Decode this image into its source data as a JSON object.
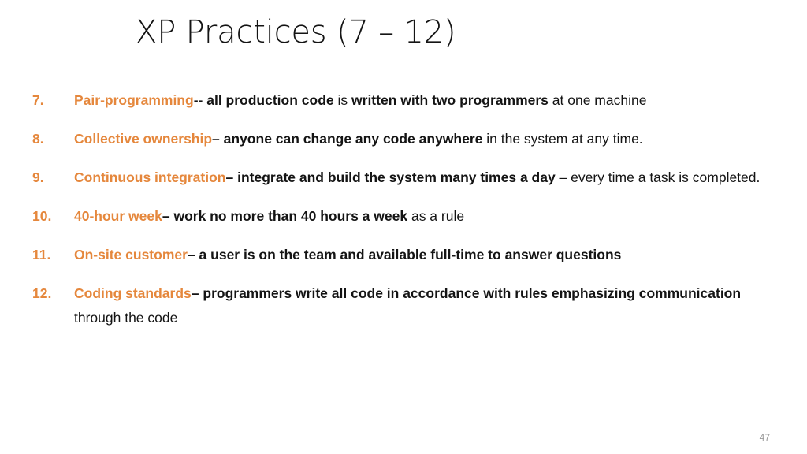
{
  "slide": {
    "title": "XP Practices (7 – 12)",
    "page_number": "47",
    "accent_color": "#E5873C",
    "text_color": "#141414",
    "background_color": "#FFFFFF"
  },
  "practices": [
    {
      "number": "7.",
      "term": "Pair-programming",
      "separator": "-- ",
      "bold1": "all production code",
      "plain1": " is ",
      "bold2": "written with two programmers",
      "plain2": " at one machine"
    },
    {
      "number": "8.",
      "term": "Collective ownership",
      "separator": "– ",
      "bold1": "anyone can change any code anywhere",
      "plain1": " in the system at any time.",
      "bold2": "",
      "plain2": ""
    },
    {
      "number": "9.",
      "term": "Continuous integration",
      "separator": "– ",
      "bold1": "integrate and build the system many times a day",
      "plain1": " – every time a task is completed.",
      "bold2": "",
      "plain2": ""
    },
    {
      "number": "10.",
      "term": "40-hour week",
      "separator": "– ",
      "bold1": "work no more than 40 hours a week",
      "plain1": " as a rule",
      "bold2": "",
      "plain2": ""
    },
    {
      "number": "11.",
      "term": "On-site customer",
      "separator": "– ",
      "bold1": "a user is on the team and available full-time to answer questions",
      "plain1": "",
      "bold2": "",
      "plain2": ""
    },
    {
      "number": "12.",
      "term": "Coding standards",
      "separator": "– ",
      "bold1": "programmers write all code in accordance with rules emphasizing communication",
      "plain1": " through the code",
      "bold2": "",
      "plain2": ""
    }
  ]
}
